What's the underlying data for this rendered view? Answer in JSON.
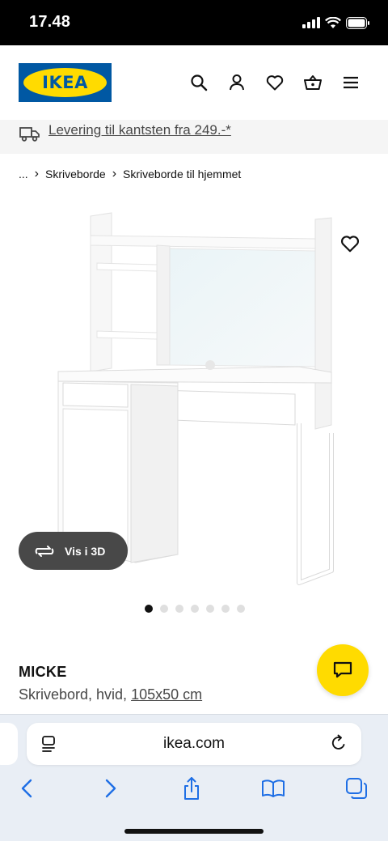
{
  "status_bar": {
    "time": "17.48",
    "icons": [
      "signal-icon",
      "wifi-icon",
      "battery-icon"
    ]
  },
  "header": {
    "logo_text": "IKEA",
    "icons": [
      "search-icon",
      "account-icon",
      "heart-icon",
      "basket-icon",
      "menu-icon"
    ]
  },
  "delivery_banner": {
    "icon": "truck-icon",
    "text": "Levering til kantsten fra 249.-*"
  },
  "breadcrumb": {
    "ellipsis": "...",
    "items": [
      "Skriveborde",
      "Skriveborde til hjemmet"
    ]
  },
  "gallery": {
    "view_3d_label": "Vis i 3D",
    "dot_count": 7,
    "active_index": 0
  },
  "product": {
    "name": "MICKE",
    "description": "Skrivebord, hvid, ",
    "size": "105x50 cm"
  },
  "browser": {
    "url": "ikea.com",
    "nav": [
      "back-icon",
      "forward-icon",
      "share-icon",
      "bookmarks-icon",
      "tabs-icon"
    ]
  },
  "colors": {
    "ikea_blue": "#0058a3",
    "ikea_yellow": "#ffdb00",
    "browser_blue": "#1f6fe5"
  }
}
